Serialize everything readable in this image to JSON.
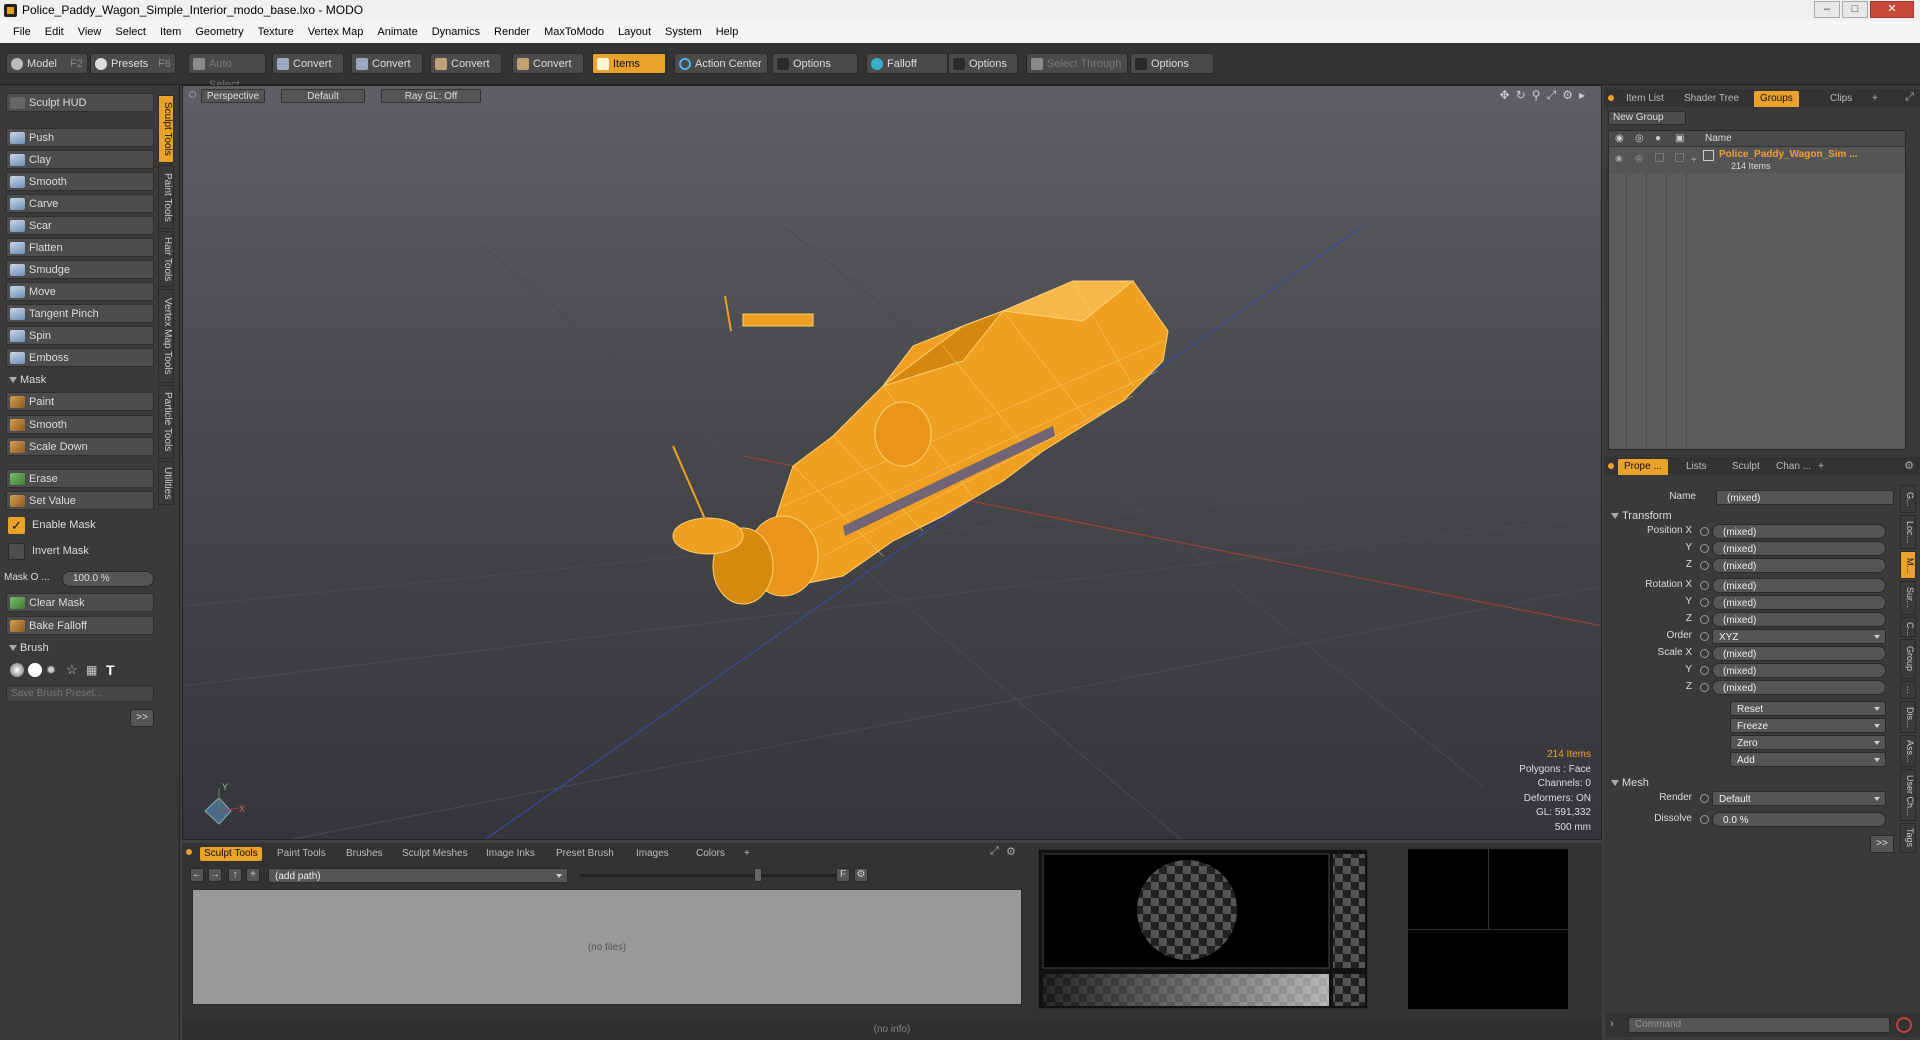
{
  "window": {
    "title": "Police_Paddy_Wagon_Simple_Interior_modo_base.lxo - MODO",
    "min": "–",
    "max": "□",
    "close": "✕"
  },
  "menu": [
    "File",
    "Edit",
    "View",
    "Select",
    "Item",
    "Geometry",
    "Texture",
    "Vertex Map",
    "Animate",
    "Dynamics",
    "Render",
    "MaxToModo",
    "Layout",
    "System",
    "Help"
  ],
  "toolbar": {
    "model": "Model",
    "model_key": "F2",
    "presets": "Presets",
    "presets_key": "F6",
    "auto_select": "Auto Select",
    "convert1": "Convert",
    "convert2": "Convert",
    "convert3": "Convert",
    "convert4": "Convert",
    "items": "Items",
    "action_center": "Action Center",
    "options1": "Options",
    "falloff": "Falloff",
    "options2": "Options",
    "select_through": "Select Through",
    "options3": "Options"
  },
  "left": {
    "hud": "Sculpt HUD",
    "tools": [
      "Push",
      "Clay",
      "Smooth",
      "Carve",
      "Scar",
      "Flatten",
      "Smudge",
      "Move",
      "Tangent Pinch",
      "Spin",
      "Emboss"
    ],
    "mask_header": "Mask",
    "mask_tools": [
      "Paint",
      "Smooth",
      "Scale Down"
    ],
    "erase": "Erase",
    "set_value": "Set Value",
    "enable_mask": "Enable Mask",
    "invert_mask": "Invert Mask",
    "mask_opacity_label": "Mask O ...",
    "mask_opacity_value": "100.0 %",
    "clear_mask": "Clear Mask",
    "bake_falloff": "Bake Falloff",
    "brush_header": "Brush",
    "save_brush": "Save Brush Preset...",
    "more": ">>"
  },
  "vtabs": [
    "Sculpt Tools",
    "Paint Tools",
    "Hair Tools",
    "Vertex Map Tools",
    "Particle Tools",
    "Utilities"
  ],
  "viewport": {
    "tabs": [
      "Perspective",
      "Default",
      "Ray GL: Off"
    ],
    "icons": [
      "move-icon",
      "rotate-icon",
      "zoom-icon",
      "fit-icon",
      "settings-icon",
      "play-icon"
    ],
    "stats": {
      "items": "214 Items",
      "polygons": "Polygons : Face",
      "channels": "Channels: 0",
      "deformers": "Deformers: ON",
      "gl": "GL: 591,332",
      "scale": "500 mm"
    },
    "axis_y": "Y",
    "axis_x": "X"
  },
  "right": {
    "top_tabs": [
      "Item List",
      "Shader Tree",
      "Groups",
      "Clips",
      "+"
    ],
    "new_group": "New Group",
    "col_name": "Name",
    "group_name": "Police_Paddy_Wagon_Sim ...",
    "group_count": "214 Items",
    "prop_tabs": [
      "Prope ...",
      "Lists",
      "Sculpt",
      "Chan ...",
      "+"
    ],
    "name_label": "Name",
    "name_value": "(mixed)",
    "transform_header": "Transform",
    "position_label": "Position X",
    "rotation_label": "Rotation X",
    "scale_label": "Scale X",
    "y": "Y",
    "z": "Z",
    "mixed": "(mixed)",
    "order_label": "Order",
    "order_value": "XYZ",
    "reset": "Reset",
    "freeze": "Freeze",
    "zero": "Zero",
    "add": "Add",
    "mesh_header": "Mesh",
    "render_label": "Render",
    "render_value": "Default",
    "dissolve_label": "Dissolve",
    "dissolve_value": "0.0 %",
    "more": ">>",
    "side_tabs": [
      "G...",
      "Loc...",
      "M...",
      "Sur...",
      "C...",
      "Group",
      "...",
      "Dis...",
      "Ass...",
      "User Ch...",
      "Tags"
    ],
    "command": "Command"
  },
  "bottom": {
    "tabs": [
      "Sculpt Tools",
      "Paint Tools",
      "Brushes",
      "Sculpt Meshes",
      "Image Inks",
      "Preset Brush",
      "Images",
      "Colors",
      "+"
    ],
    "path": "(add path)",
    "no_files": "(no files)",
    "f_btn": "F"
  },
  "status": "(no info)"
}
